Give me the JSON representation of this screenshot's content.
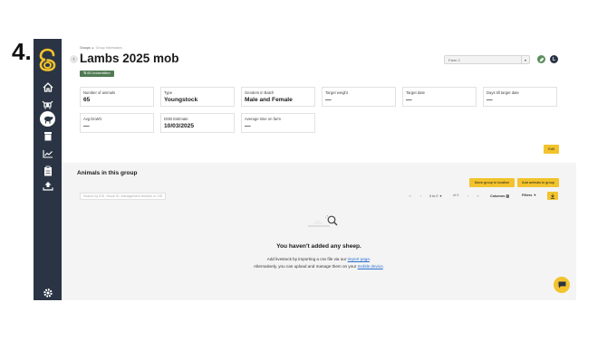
{
  "step_marker": "4.",
  "breadcrumb": {
    "parent": "Groups",
    "current": "Group Information"
  },
  "page": {
    "title": "Lambs 2025 mob",
    "badge": "65 Unidentified"
  },
  "header": {
    "farm_select": "Farm 2",
    "avatar_initial": "L"
  },
  "stats": [
    {
      "label": "Number of animals",
      "value": "65"
    },
    {
      "label": "Type",
      "value": "Youngstock"
    },
    {
      "label": "Genders in Batch",
      "value": "Male and Female"
    },
    {
      "label": "Target weight",
      "value": "—"
    },
    {
      "label": "Target date",
      "value": "—"
    },
    {
      "label": "Days till target date",
      "value": "—"
    },
    {
      "label": "Avg DLWG",
      "value": "—"
    },
    {
      "label": "DOB Estimate",
      "value": "10/03/2025"
    },
    {
      "label": "Average time on farm",
      "value": "—"
    }
  ],
  "buttons": {
    "edit": "Edit",
    "move_group": "Move group to location",
    "add_animals": "Add animals to group"
  },
  "group_section": {
    "title": "Animals in this group",
    "search_placeholder": "Search by EID, Visual ID, Management Number or VID",
    "per_page": "0 to 0",
    "of_label": "of 0",
    "columns_label": "Columns",
    "filters_label": "Filters"
  },
  "empty_state": {
    "title": "You haven't added any sheep.",
    "line1_prefix": "Add livestock by importing a csv file via our",
    "line1_link": "import page",
    "line2_prefix": "Alternatively, you can upload and manage them on your",
    "line2_link": "mobile device"
  },
  "sidebar": {
    "items": [
      "logo-icon",
      "home-icon",
      "cattle-icon",
      "sheep-icon",
      "feed-icon",
      "reports-icon",
      "tasks-icon",
      "upload-icon",
      "settings-icon"
    ]
  },
  "colors": {
    "sidebar": "#2a3444",
    "accent_yellow": "#f2c32c",
    "badge_green": "#4f7a52",
    "link_blue": "#2b6fd1"
  }
}
